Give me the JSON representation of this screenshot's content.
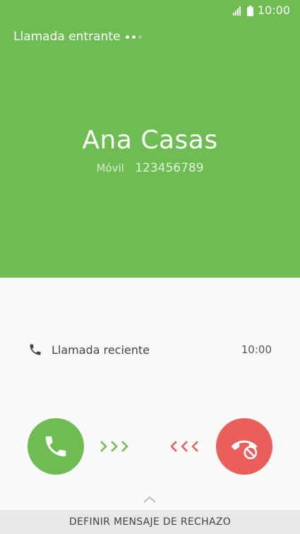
{
  "status_bar": {
    "time": "10:00"
  },
  "call": {
    "incoming_label": "Llamada entrante",
    "caller_name": "Ana Casas",
    "number_type": "Móvil",
    "number": "123456789"
  },
  "recent": {
    "label": "Llamada reciente",
    "time": "10:00"
  },
  "footer": {
    "reject_message_label": "DEFINIR MENSAJE DE RECHAZO"
  },
  "colors": {
    "accept": "#6dbd52",
    "reject": "#ec5e5a",
    "header": "#6dbd52"
  }
}
